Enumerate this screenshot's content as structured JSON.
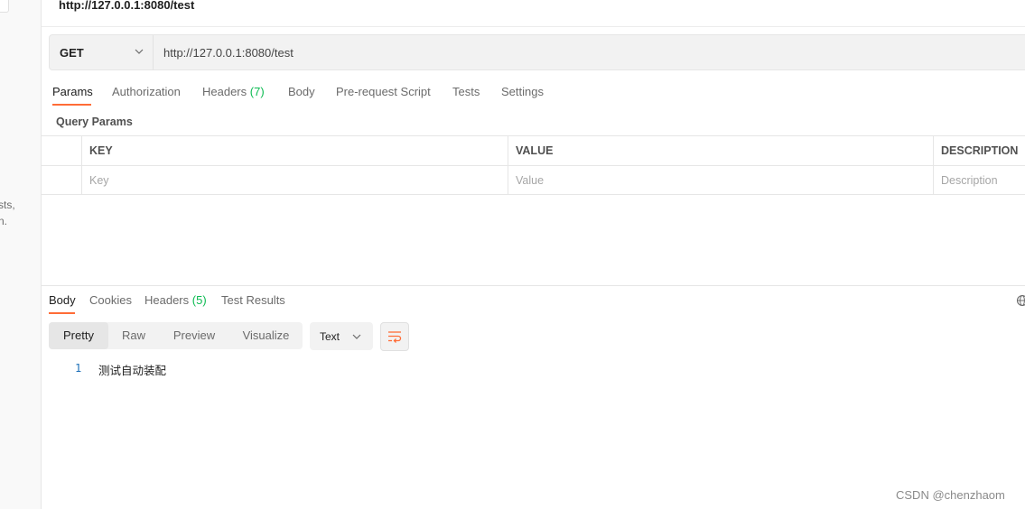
{
  "sidebar": {
    "fragment_line1": "sts,",
    "fragment_line2": "n."
  },
  "request": {
    "title": "http://127.0.0.1:8080/test",
    "method": "GET",
    "url": "http://127.0.0.1:8080/test"
  },
  "request_tabs": [
    {
      "label": "Params",
      "active": true
    },
    {
      "label": "Authorization"
    },
    {
      "label": "Headers",
      "count": "(7)"
    },
    {
      "label": "Body"
    },
    {
      "label": "Pre-request Script"
    },
    {
      "label": "Tests"
    },
    {
      "label": "Settings"
    }
  ],
  "query_params": {
    "title": "Query Params",
    "headers": {
      "key": "KEY",
      "value": "VALUE",
      "description": "DESCRIPTION"
    },
    "placeholders": {
      "key": "Key",
      "value": "Value",
      "description": "Description"
    }
  },
  "response_tabs": [
    {
      "label": "Body",
      "active": true
    },
    {
      "label": "Cookies"
    },
    {
      "label": "Headers",
      "count": "(5)"
    },
    {
      "label": "Test Results"
    }
  ],
  "view_modes": [
    {
      "label": "Pretty",
      "active": true
    },
    {
      "label": "Raw"
    },
    {
      "label": "Preview"
    },
    {
      "label": "Visualize"
    }
  ],
  "format_select": "Text",
  "response_body": {
    "line_number": "1",
    "content": "测试自动装配"
  },
  "watermark": "CSDN @chenzhaom",
  "colors": {
    "accent": "#ff6c37",
    "count_green": "#0cbb52",
    "line_number_blue": "#1c6fb8"
  },
  "icons": [
    "more-dots-icon",
    "chevron-down-icon",
    "globe-icon",
    "wrap-lines-icon"
  ]
}
